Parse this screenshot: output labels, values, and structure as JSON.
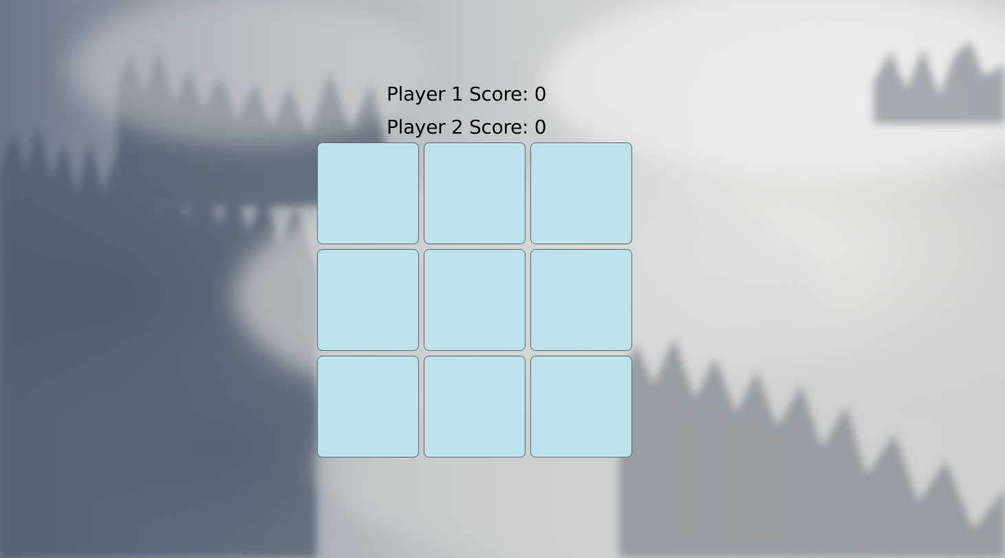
{
  "scores": {
    "player1": "Player 1 Score: 0",
    "player2": "Player 2 Score: 0"
  },
  "board": {
    "cells": [
      "",
      "",
      "",
      "",
      "",
      "",
      "",
      "",
      ""
    ]
  },
  "colors": {
    "cell_fill": "#bce3ea",
    "cell_border": "#5d6468",
    "text": "#000000"
  }
}
